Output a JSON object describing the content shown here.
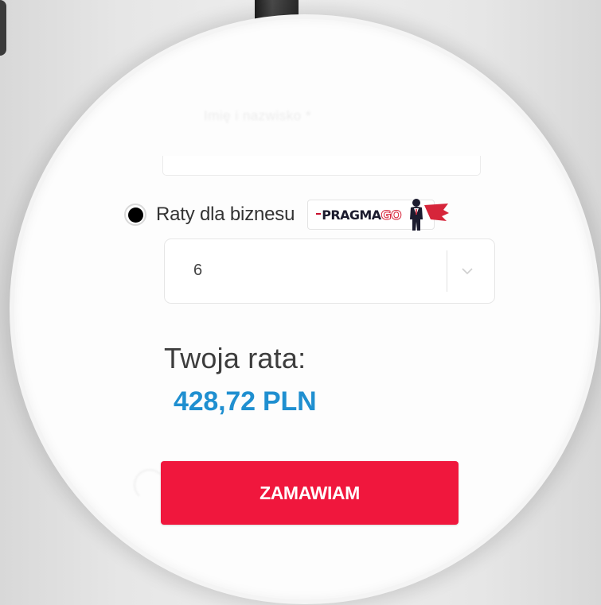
{
  "form": {
    "faded_label": "Imię i nazwisko *",
    "payment_option": {
      "label": "Raty dla biznesu",
      "selected": true,
      "provider": {
        "name_part1": "PRAGMA",
        "name_part2": "GO",
        "registered_mark": "®"
      }
    },
    "installments_select": {
      "value": "6"
    },
    "rate": {
      "label": "Twoja rata:",
      "value": "428,72 PLN"
    },
    "order_button_label": "ZAMAWIAM"
  },
  "colors": {
    "accent_blue": "#1f8fd0",
    "button_red": "#f0173d",
    "brand_red": "#d6253a"
  },
  "icons": {
    "select": "chevron-down-icon",
    "radio": "radio-selected-icon",
    "brand_mascot": "superhero-mascot-icon"
  }
}
